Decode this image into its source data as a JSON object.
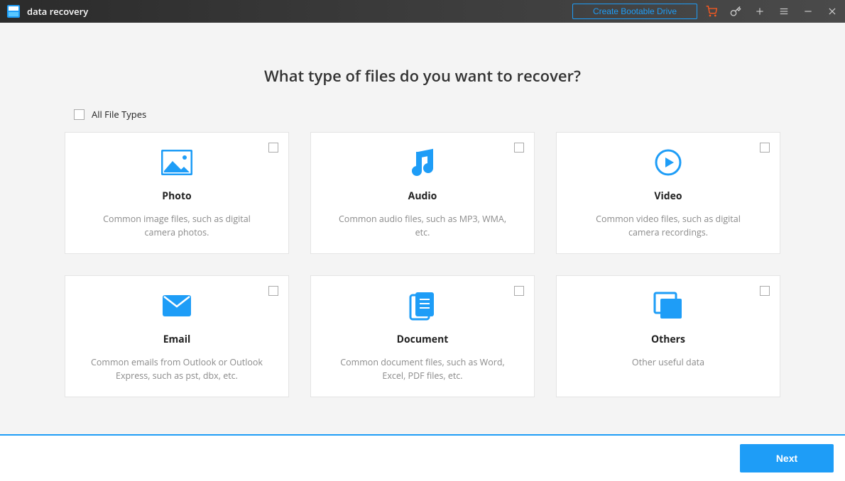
{
  "titlebar": {
    "app_name": "data recovery",
    "bootable_label": "Create Bootable Drive"
  },
  "heading": "What type of files do you want to recover?",
  "all_types_label": "All File Types",
  "cards": {
    "photo": {
      "title": "Photo",
      "desc": "Common image files, such as digital camera photos."
    },
    "audio": {
      "title": "Audio",
      "desc": "Common audio files, such as MP3, WMA, etc."
    },
    "video": {
      "title": "Video",
      "desc": "Common video files, such as digital camera recordings."
    },
    "email": {
      "title": "Email",
      "desc": "Common emails from Outlook or Outlook Express, such as pst, dbx, etc."
    },
    "document": {
      "title": "Document",
      "desc": "Common document files, such as Word, Excel, PDF files, etc."
    },
    "others": {
      "title": "Others",
      "desc": "Other useful data"
    }
  },
  "footer": {
    "next_label": "Next"
  },
  "colors": {
    "accent": "#1e9df7",
    "cart": "#ff5a1f"
  }
}
